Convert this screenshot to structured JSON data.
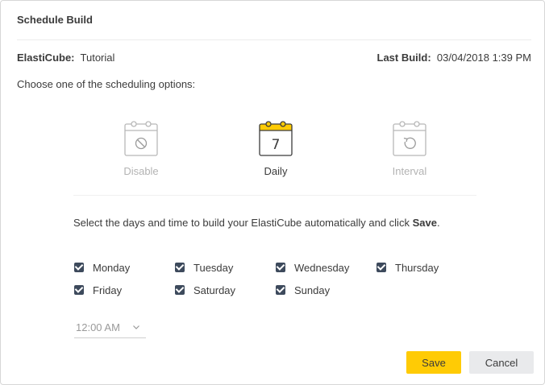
{
  "dialog": {
    "title": "Schedule Build",
    "elasticube_label": "ElastiCube:",
    "elasticube_value": "Tutorial",
    "last_build_label": "Last Build:",
    "last_build_value": "03/04/2018 1:39 PM",
    "choose_text": "Choose one of the scheduling options:"
  },
  "tabs": [
    {
      "label": "Disable",
      "icon": "calendar-disable-icon",
      "active": false
    },
    {
      "label": "Daily",
      "icon": "calendar-daily-icon",
      "active": true,
      "icon_text": "7"
    },
    {
      "label": "Interval",
      "icon": "calendar-interval-icon",
      "active": false
    }
  ],
  "instructions": {
    "text": "Select the days and time to build your ElastiCube automatically and click ",
    "emphasis": "Save",
    "suffix": "."
  },
  "days": [
    {
      "label": "Monday",
      "checked": true
    },
    {
      "label": "Tuesday",
      "checked": true
    },
    {
      "label": "Wednesday",
      "checked": true
    },
    {
      "label": "Thursday",
      "checked": true
    },
    {
      "label": "Friday",
      "checked": true
    },
    {
      "label": "Saturday",
      "checked": true
    },
    {
      "label": "Sunday",
      "checked": true
    }
  ],
  "time": {
    "value": "12:00 AM"
  },
  "buttons": {
    "save": "Save",
    "cancel": "Cancel"
  },
  "colors": {
    "accent": "#ffcb05",
    "checkbox": "#3d4a5c",
    "cancel_bg": "#e9eaec"
  }
}
